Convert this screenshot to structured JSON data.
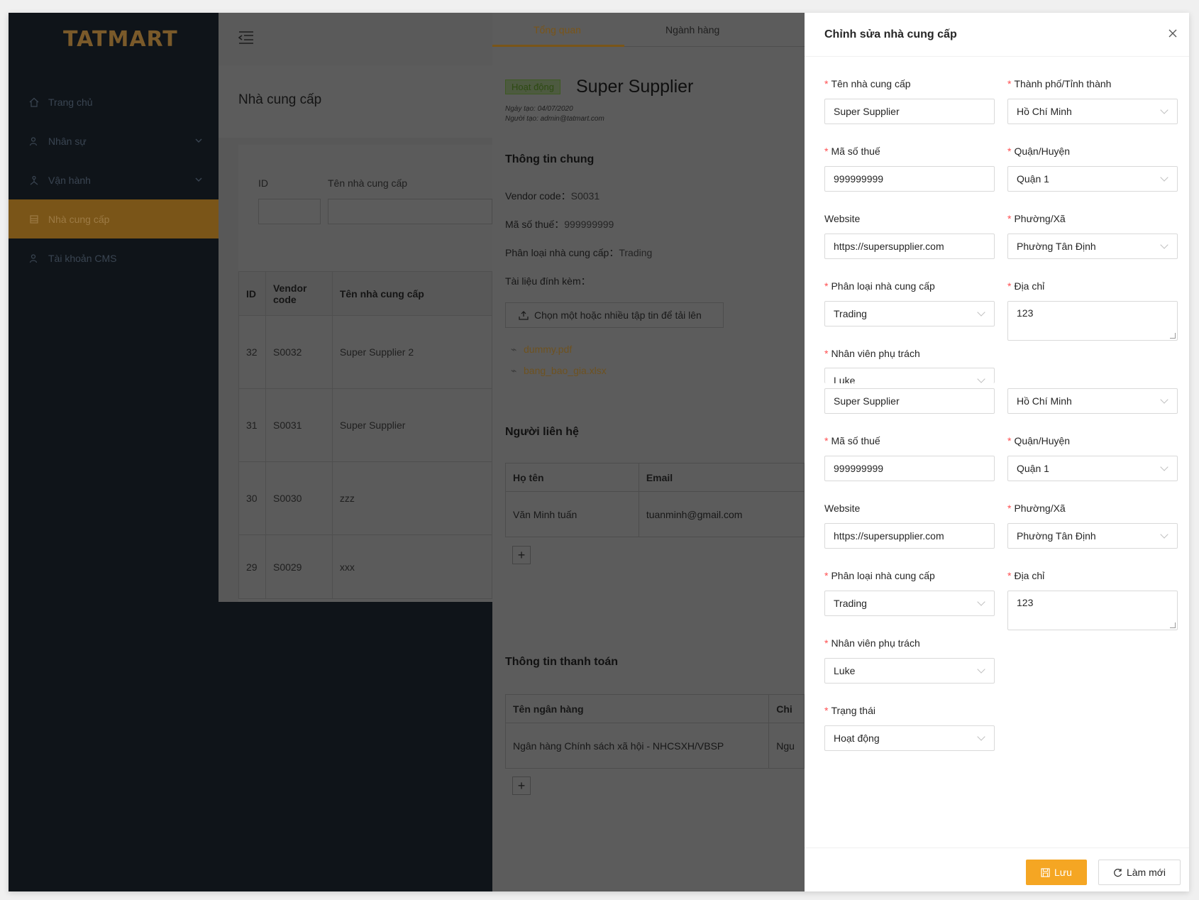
{
  "sidebar": {
    "logo": "TATMART",
    "items": [
      {
        "label": "Trang chủ",
        "icon": "home-icon"
      },
      {
        "label": "Nhân sự",
        "icon": "users-icon"
      },
      {
        "label": "Vận hành",
        "icon": "operation-icon"
      },
      {
        "label": "Nhà cung cấp",
        "icon": "supplier-icon"
      },
      {
        "label": "Tài khoản CMS",
        "icon": "account-icon"
      }
    ]
  },
  "page": {
    "title": "Nhà cung cấp",
    "filters": {
      "id_label": "ID",
      "name_label": "Tên nhà cung cấp"
    },
    "table": {
      "headers": [
        "ID",
        "Vendor code",
        "Tên nhà cung cấp"
      ],
      "rows": [
        [
          "32",
          "S0032",
          "Super Supplier 2"
        ],
        [
          "31",
          "S0031",
          "Super Supplier"
        ],
        [
          "30",
          "S0030",
          "zzz"
        ],
        [
          "29",
          "S0029",
          "xxx"
        ]
      ]
    }
  },
  "detail": {
    "tabs": [
      "Tổng quan",
      "Ngành hàng"
    ],
    "status": "Hoạt động",
    "name": "Super Supplier",
    "created_date": "Ngày tạo: 04/07/2020",
    "created_by": "Người tạo: admin@tatmart.com",
    "general_title": "Thông tin chung",
    "vendor_code_label": "Vendor code：",
    "vendor_code": "S0031",
    "tax_label": "Mã số thuế：",
    "tax": "999999999",
    "type_label": "Phân loại nhà cung cấp：",
    "type": "Trading",
    "attach_label": "Tài liệu đính kèm：",
    "upload_label": "Chọn một hoặc nhiều tập tin để tải lên",
    "files": [
      "dummy.pdf",
      "bang_bao_gia.xlsx"
    ],
    "contacts_title": "Người liên hệ",
    "contacts_headers": [
      "Họ tên",
      "Email"
    ],
    "contacts_rows": [
      [
        "Văn Minh tuấn",
        "tuanminh@gmail.com"
      ]
    ],
    "payment_title": "Thông tin thanh toán",
    "payment_headers": [
      "Tên ngân hàng",
      "Chi"
    ],
    "payment_rows": [
      [
        "Ngân hàng Chính sách xã hội - NHCSXH/VBSP",
        "Ngu"
      ]
    ]
  },
  "drawer": {
    "title": "Chỉnh sửa nhà cung cấp",
    "labels": {
      "name": "Tên nhà cung cấp",
      "city": "Thành phố/Tỉnh thành",
      "tax": "Mã số thuế",
      "district": "Quận/Huyện",
      "website": "Website",
      "ward": "Phường/Xã",
      "type": "Phân loại nhà cung cấp",
      "address": "Địa chỉ",
      "staff": "Nhân viên phụ trách",
      "status": "Trạng thái"
    },
    "values": {
      "name": "Super Supplier",
      "city": "Hồ Chí Minh",
      "tax": "999999999",
      "district": "Quận 1",
      "website": "https://supersupplier.com",
      "ward": "Phường Tân Định",
      "type": "Trading",
      "address": "123",
      "staff": "Luke",
      "status": "Hoạt động"
    },
    "save_label": "Lưu",
    "reset_label": "Làm mới"
  },
  "colors": {
    "accent": "#f5a623",
    "required": "#ff4d4f",
    "sidebar_bg": "#0f1419"
  }
}
